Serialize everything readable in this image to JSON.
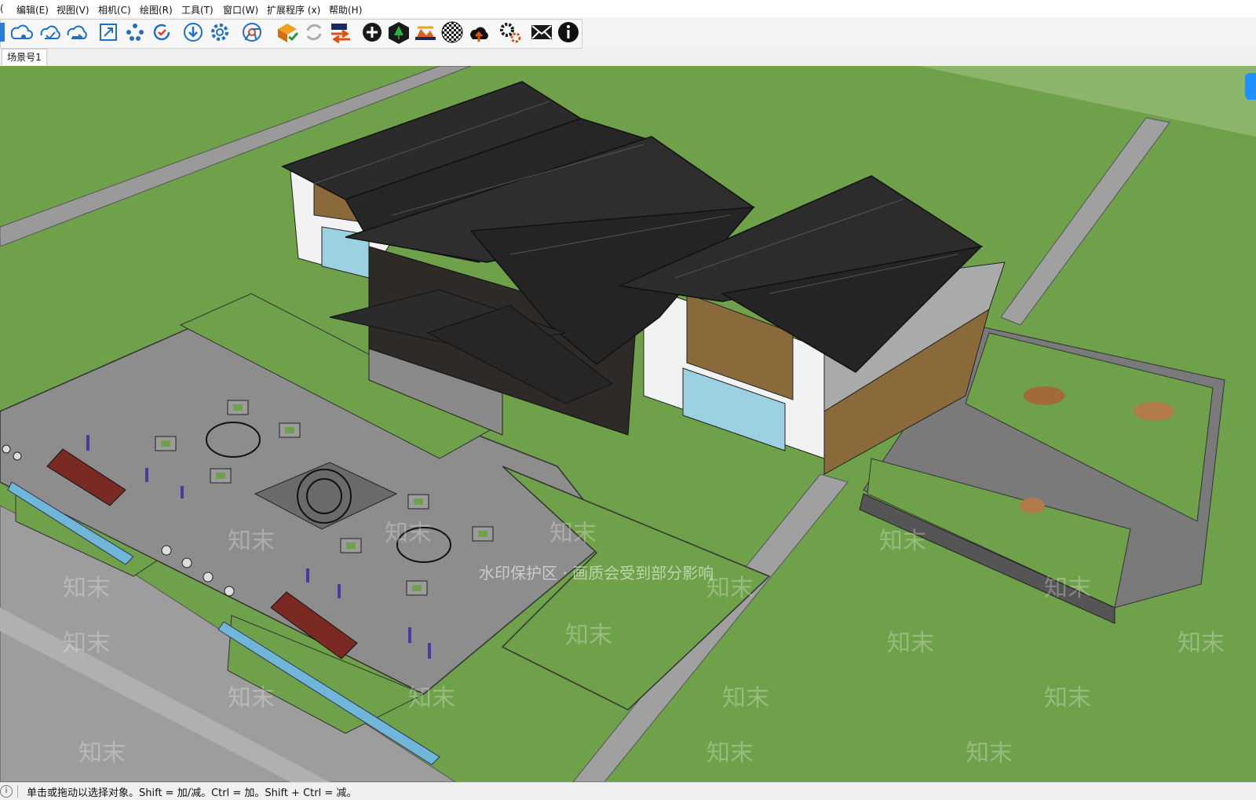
{
  "menubar": {
    "items": [
      {
        "label": "编辑(E)"
      },
      {
        "label": "视图(V)"
      },
      {
        "label": "相机(C)"
      },
      {
        "label": "绘图(R)"
      },
      {
        "label": "工具(T)"
      },
      {
        "label": "窗口(W)"
      },
      {
        "label": "扩展程序 (x)"
      },
      {
        "label": "帮助(H)"
      }
    ],
    "first_item_partial": "("
  },
  "toolbar": {
    "icons": [
      "select-icon",
      "component-tag-icon",
      "cloud-check-icon",
      "cloud-sync-icon",
      "zoom-extents-icon",
      "share-nodes-icon",
      "refresh-check-icon",
      "download-icon",
      "settings-icon",
      "chrome-icon",
      "extension-warehouse-icon",
      "reload-icon",
      "swap-icon",
      "add-circle-icon",
      "tree-icon",
      "terrain-icon",
      "checker-icon",
      "cloud-upload-icon",
      "gears-icon",
      "mail-icon",
      "info-icon"
    ]
  },
  "scene_tab": {
    "label": "场景号1"
  },
  "viewport": {
    "watermark_banner": "水印保护区 · 画质会受到部分影响",
    "watermark_text": "知末",
    "colors": {
      "grass": "#6ea14a",
      "paving": "#8d8d8d",
      "roof": "#2b2b2b",
      "wood": "#8a6a3a",
      "wall": "#f2f2f2",
      "glass": "#9bd1e0",
      "water": "#6fb6d8"
    }
  },
  "statusbar": {
    "icon": "i",
    "text": "单击或拖动以选择对象。Shift = 加/减。Ctrl = 加。Shift + Ctrl = 减。"
  }
}
